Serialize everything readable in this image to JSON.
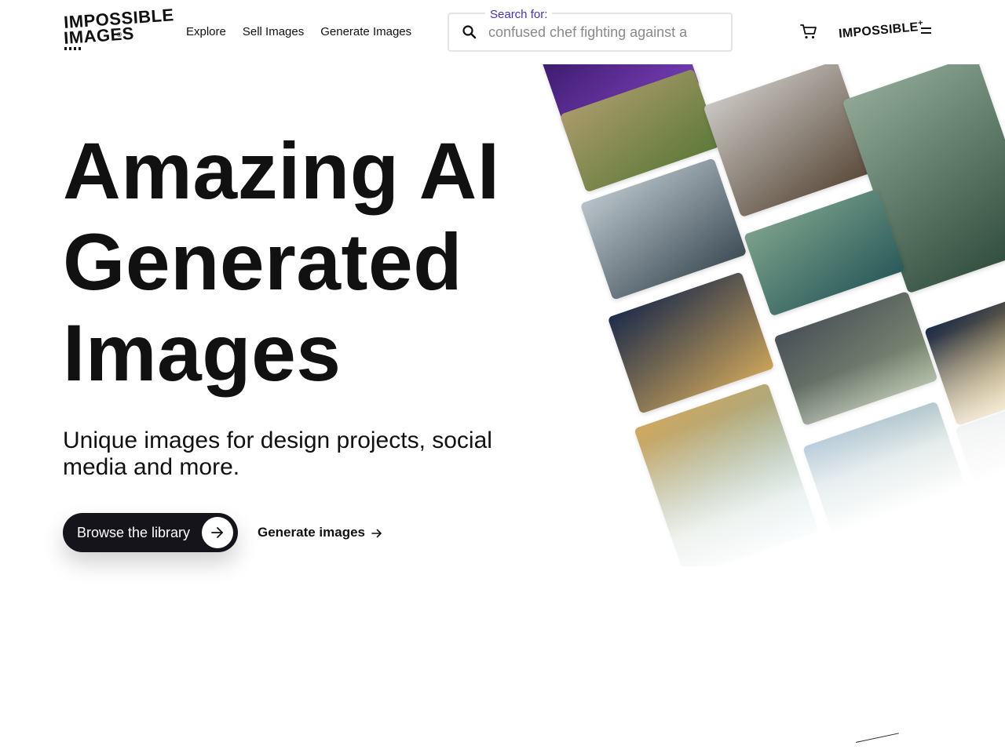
{
  "header": {
    "logo": {
      "line1": "IMPOSSIBLE",
      "line2": "IMAGES",
      "reg": "®"
    },
    "nav": [
      "Explore",
      "Sell Images",
      "Generate Images"
    ],
    "search": {
      "label": "Search for:",
      "placeholder": "confused chef fighting against a"
    },
    "plus_logo": {
      "text": "IMPOSSIBLE",
      "plus": "+"
    }
  },
  "hero": {
    "title_lines": [
      "Amazing AI",
      "Generated",
      "Images"
    ],
    "subtitle": "Unique images for design projects, social media and more.",
    "primary_button": "Browse the library",
    "secondary_button": "Generate images"
  },
  "gallery": {
    "images": [
      {
        "subject": "purple-abstract",
        "colors": [
          "#3a1a6b",
          "#7a3fb8"
        ]
      },
      {
        "subject": "fox-warrior-in-wheat-field",
        "colors": [
          "#a99a6a",
          "#5e7a3a"
        ]
      },
      {
        "subject": "lemur-on-branch",
        "colors": [
          "#c9c6c2",
          "#5a4a3a"
        ]
      },
      {
        "subject": "antlered-forest-creature",
        "colors": [
          "#8fa896",
          "#2e4a3a"
        ]
      },
      {
        "subject": "sea-rocks-coast",
        "colors": [
          "#b8c3c9",
          "#3f4e58"
        ]
      },
      {
        "subject": "teal-creature-waterfall",
        "colors": [
          "#7ba08a",
          "#2a5a5a"
        ]
      },
      {
        "subject": "hourglass-at-night",
        "colors": [
          "#1e2c4a",
          "#c9a25a"
        ]
      },
      {
        "subject": "stormy-road",
        "colors": [
          "#4a5058",
          "#8a9a7a"
        ]
      },
      {
        "subject": "golden-bokeh",
        "colors": [
          "#1a2a4a",
          "#e0b040"
        ]
      },
      {
        "subject": "autumn-fairy-forest",
        "colors": [
          "#d0a860",
          "#6aaab0"
        ]
      },
      {
        "subject": "lake-with-hills",
        "colors": [
          "#7aa0c0",
          "#3a6a4a"
        ]
      },
      {
        "subject": "partial-tile",
        "colors": [
          "#c0c4c8",
          "#9aa0a8"
        ]
      }
    ]
  }
}
